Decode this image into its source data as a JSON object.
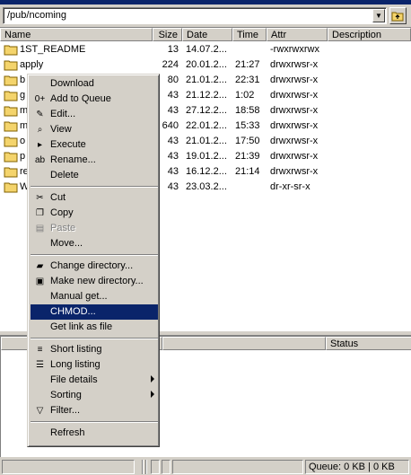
{
  "path": {
    "value": "/pub/ncoming"
  },
  "file_list": {
    "columns": [
      "Name",
      "Size",
      "Date",
      "Time",
      "Attr",
      "Description"
    ],
    "rows": [
      {
        "name": "1ST_README",
        "size": "13",
        "date": "14.07.2...",
        "time": "",
        "attr": "-rwxrwxrwx"
      },
      {
        "name": "apply",
        "size": "224",
        "date": "20.01.2...",
        "time": "21:27",
        "attr": "drwxrwsr-x"
      },
      {
        "name": "b",
        "size": "80",
        "date": "21.01.2...",
        "time": "22:31",
        "attr": "drwxrwsr-x"
      },
      {
        "name": "g",
        "size": "43",
        "date": "21.12.2...",
        "time": "1:02",
        "attr": "drwxrwsr-x"
      },
      {
        "name": "m",
        "size": "43",
        "date": "27.12.2...",
        "time": "18:58",
        "attr": "drwxrwsr-x"
      },
      {
        "name": "m",
        "size": "640",
        "date": "22.01.2...",
        "time": "15:33",
        "attr": "drwxrwsr-x"
      },
      {
        "name": "o",
        "size": "43",
        "date": "21.01.2...",
        "time": "17:50",
        "attr": "drwxrwsr-x"
      },
      {
        "name": "p",
        "size": "43",
        "date": "19.01.2...",
        "time": "21:39",
        "attr": "drwxrwsr-x"
      },
      {
        "name": "re",
        "size": "43",
        "date": "16.12.2...",
        "time": "21:14",
        "attr": "drwxrwsr-x"
      },
      {
        "name": "W",
        "size": "43",
        "date": "23.03.2...",
        "time": "",
        "attr": "dr-xr-sr-x"
      }
    ]
  },
  "queue": {
    "columns": [
      "",
      "",
      "Status"
    ]
  },
  "status_bar": {
    "queue": "Queue: 0 KB | 0 KB"
  },
  "context_menu": {
    "items": [
      {
        "label": "Download",
        "icon": "",
        "disabled": false,
        "submenu": false,
        "selected": false
      },
      {
        "label": "Add to Queue",
        "icon": "0+",
        "disabled": false,
        "submenu": false,
        "selected": false
      },
      {
        "label": "Edit...",
        "icon": "edit-icon",
        "disabled": false,
        "submenu": false,
        "selected": false
      },
      {
        "label": "View",
        "icon": "magnifier-icon",
        "disabled": false,
        "submenu": false,
        "selected": false
      },
      {
        "label": "Execute",
        "icon": "run-icon",
        "disabled": false,
        "submenu": false,
        "selected": false
      },
      {
        "label": "Rename...",
        "icon": "rename-icon",
        "disabled": false,
        "submenu": false,
        "selected": false
      },
      {
        "label": "Delete",
        "icon": "",
        "disabled": false,
        "submenu": false,
        "selected": false
      },
      {
        "sep": true
      },
      {
        "label": "Cut",
        "icon": "scissors-icon",
        "disabled": false,
        "submenu": false,
        "selected": false
      },
      {
        "label": "Copy",
        "icon": "copy-icon",
        "disabled": false,
        "submenu": false,
        "selected": false
      },
      {
        "label": "Paste",
        "icon": "paste-icon",
        "disabled": true,
        "submenu": false,
        "selected": false
      },
      {
        "label": "Move...",
        "icon": "",
        "disabled": false,
        "submenu": false,
        "selected": false
      },
      {
        "sep": true
      },
      {
        "label": "Change directory...",
        "icon": "folder-icon",
        "disabled": false,
        "submenu": false,
        "selected": false
      },
      {
        "label": "Make new directory...",
        "icon": "new-folder-icon",
        "disabled": false,
        "submenu": false,
        "selected": false
      },
      {
        "label": "Manual get...",
        "icon": "",
        "disabled": false,
        "submenu": false,
        "selected": false
      },
      {
        "label": "CHMOD...",
        "icon": "",
        "disabled": false,
        "submenu": false,
        "selected": true
      },
      {
        "label": "Get link as file",
        "icon": "",
        "disabled": false,
        "submenu": false,
        "selected": false
      },
      {
        "sep": true
      },
      {
        "label": "Short listing",
        "icon": "short-list-icon",
        "disabled": false,
        "submenu": false,
        "selected": false
      },
      {
        "label": "Long listing",
        "icon": "long-list-icon",
        "disabled": false,
        "submenu": false,
        "selected": false
      },
      {
        "label": "File details",
        "icon": "",
        "disabled": false,
        "submenu": true,
        "selected": false
      },
      {
        "label": "Sorting",
        "icon": "",
        "disabled": false,
        "submenu": true,
        "selected": false
      },
      {
        "label": "Filter...",
        "icon": "filter-icon",
        "disabled": false,
        "submenu": false,
        "selected": false
      },
      {
        "sep": true
      },
      {
        "label": "Refresh",
        "icon": "",
        "disabled": false,
        "submenu": false,
        "selected": false
      }
    ]
  },
  "colors": {
    "selection": "#0a246a",
    "face": "#d4d0c8",
    "folder": "#f4d46c"
  }
}
